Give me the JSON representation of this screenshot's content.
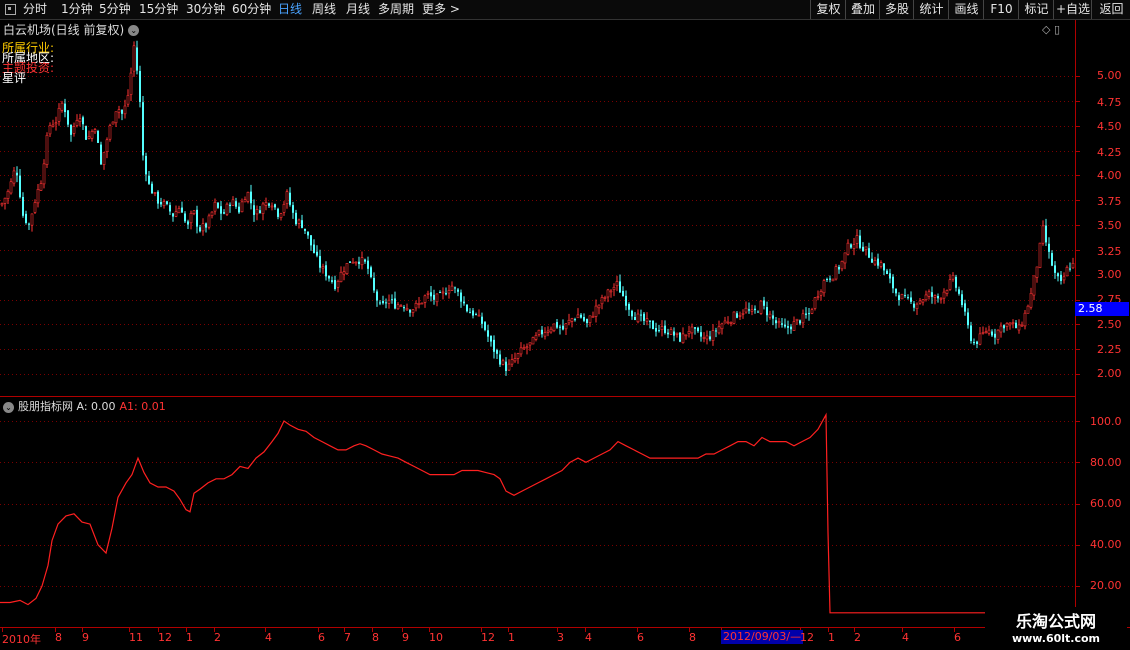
{
  "toolbar": {
    "periods": [
      "分时",
      "1分钟",
      "5分钟",
      "15分钟",
      "30分钟",
      "60分钟",
      "日线",
      "周线",
      "月线",
      "多周期",
      "更多 >"
    ],
    "active_period": "日线",
    "buttons": [
      "复权",
      "叠加",
      "多股",
      "统计",
      "画线",
      "F10",
      "标记",
      "+自选",
      "返回"
    ]
  },
  "main_panel": {
    "title": "白云机场(日线 前复权)",
    "info_lines": [
      {
        "text": "所属行业:",
        "color": "#ffcc00"
      },
      {
        "text": "所属地区:",
        "color": "#ffffff"
      },
      {
        "text": "主题投资:",
        "color": "#ff3333"
      },
      {
        "text": "星评",
        "color": "#ffffff"
      }
    ],
    "price_ticks": [
      "5.00",
      "4.75",
      "4.50",
      "4.25",
      "4.00",
      "3.75",
      "3.50",
      "3.25",
      "3.00",
      "2.75",
      "2.50",
      "2.25",
      "2.00"
    ],
    "current_price": "2.58"
  },
  "indicator_panel": {
    "name": "股朋指标网",
    "a_label": "A: 0.00",
    "a1_label": "A1: 0.01",
    "ticks": [
      "100.0",
      "80.00",
      "60.00",
      "40.00",
      "20.00"
    ]
  },
  "dates": [
    "2010年",
    "8",
    "9",
    "11",
    "12",
    "1",
    "2",
    "4",
    "6",
    "7",
    "8",
    "9",
    "10",
    "12",
    "1",
    "3",
    "4",
    "6",
    "8",
    "12",
    "1",
    "2",
    "4",
    "6"
  ],
  "highlight_date": "2012/09/03/—",
  "watermark": {
    "line1": "乐淘公式网",
    "line2": "www.60lt.com"
  },
  "colors": {
    "up": "#ff3333",
    "down": "#54ffff",
    "grid": "#7a0000",
    "axis": "#b00000",
    "line": "#ff2020"
  },
  "chart_data": {
    "type": "candlestick",
    "price_ylim": [
      2.0,
      5.0
    ],
    "price_path": [
      [
        0,
        3.7
      ],
      [
        8,
        3.85
      ],
      [
        15,
        4.1
      ],
      [
        22,
        3.6
      ],
      [
        28,
        3.5
      ],
      [
        34,
        3.75
      ],
      [
        40,
        3.95
      ],
      [
        48,
        4.5
      ],
      [
        55,
        4.55
      ],
      [
        62,
        4.75
      ],
      [
        70,
        4.4
      ],
      [
        78,
        4.65
      ],
      [
        86,
        4.35
      ],
      [
        94,
        4.5
      ],
      [
        100,
        4.1
      ],
      [
        108,
        4.45
      ],
      [
        116,
        4.7
      ],
      [
        122,
        4.6
      ],
      [
        128,
        4.85
      ],
      [
        133,
        5.3
      ],
      [
        138,
        4.9
      ],
      [
        142,
        4.2
      ],
      [
        148,
        3.9
      ],
      [
        156,
        3.75
      ],
      [
        164,
        3.7
      ],
      [
        172,
        3.6
      ],
      [
        180,
        3.7
      ],
      [
        186,
        3.45
      ],
      [
        192,
        3.65
      ],
      [
        198,
        3.45
      ],
      [
        206,
        3.5
      ],
      [
        214,
        3.7
      ],
      [
        222,
        3.6
      ],
      [
        230,
        3.75
      ],
      [
        238,
        3.65
      ],
      [
        246,
        3.85
      ],
      [
        254,
        3.6
      ],
      [
        262,
        3.7
      ],
      [
        270,
        3.75
      ],
      [
        278,
        3.6
      ],
      [
        286,
        3.8
      ],
      [
        294,
        3.55
      ],
      [
        302,
        3.5
      ],
      [
        310,
        3.3
      ],
      [
        318,
        3.1
      ],
      [
        326,
        3.0
      ],
      [
        334,
        2.9
      ],
      [
        342,
        3.05
      ],
      [
        350,
        3.15
      ],
      [
        358,
        3.15
      ],
      [
        366,
        3.1
      ],
      [
        372,
        2.85
      ],
      [
        380,
        2.65
      ],
      [
        386,
        2.75
      ],
      [
        394,
        2.7
      ],
      [
        402,
        2.7
      ],
      [
        410,
        2.65
      ],
      [
        418,
        2.7
      ],
      [
        426,
        2.8
      ],
      [
        434,
        2.75
      ],
      [
        442,
        2.8
      ],
      [
        450,
        2.9
      ],
      [
        458,
        2.8
      ],
      [
        466,
        2.65
      ],
      [
        474,
        2.6
      ],
      [
        482,
        2.5
      ],
      [
        490,
        2.3
      ],
      [
        498,
        2.15
      ],
      [
        506,
        2.05
      ],
      [
        514,
        2.15
      ],
      [
        522,
        2.25
      ],
      [
        530,
        2.3
      ],
      [
        538,
        2.4
      ],
      [
        546,
        2.45
      ],
      [
        554,
        2.5
      ],
      [
        562,
        2.45
      ],
      [
        570,
        2.55
      ],
      [
        578,
        2.6
      ],
      [
        586,
        2.5
      ],
      [
        594,
        2.65
      ],
      [
        602,
        2.75
      ],
      [
        610,
        2.85
      ],
      [
        616,
        2.9
      ],
      [
        624,
        2.75
      ],
      [
        632,
        2.6
      ],
      [
        640,
        2.55
      ],
      [
        648,
        2.5
      ],
      [
        656,
        2.45
      ],
      [
        664,
        2.45
      ],
      [
        672,
        2.4
      ],
      [
        680,
        2.35
      ],
      [
        688,
        2.45
      ],
      [
        696,
        2.4
      ],
      [
        704,
        2.35
      ],
      [
        712,
        2.4
      ],
      [
        720,
        2.5
      ],
      [
        728,
        2.55
      ],
      [
        736,
        2.6
      ],
      [
        744,
        2.65
      ],
      [
        752,
        2.6
      ],
      [
        760,
        2.7
      ],
      [
        768,
        2.6
      ],
      [
        776,
        2.5
      ],
      [
        784,
        2.45
      ],
      [
        792,
        2.5
      ],
      [
        800,
        2.55
      ],
      [
        808,
        2.6
      ],
      [
        816,
        2.8
      ],
      [
        824,
        2.95
      ],
      [
        832,
        3.0
      ],
      [
        840,
        3.1
      ],
      [
        848,
        3.3
      ],
      [
        856,
        3.35
      ],
      [
        864,
        3.25
      ],
      [
        872,
        3.15
      ],
      [
        880,
        3.1
      ],
      [
        888,
        2.95
      ],
      [
        896,
        2.8
      ],
      [
        904,
        2.75
      ],
      [
        912,
        2.7
      ],
      [
        920,
        2.75
      ],
      [
        928,
        2.8
      ],
      [
        936,
        2.75
      ],
      [
        944,
        2.85
      ],
      [
        952,
        2.95
      ],
      [
        960,
        2.75
      ],
      [
        966,
        2.5
      ],
      [
        972,
        2.3
      ],
      [
        978,
        2.35
      ],
      [
        986,
        2.45
      ],
      [
        994,
        2.4
      ],
      [
        1002,
        2.5
      ],
      [
        1010,
        2.5
      ],
      [
        1018,
        2.45
      ],
      [
        1024,
        2.6
      ],
      [
        1030,
        2.8
      ],
      [
        1036,
        3.1
      ],
      [
        1042,
        3.45
      ],
      [
        1048,
        3.2
      ],
      [
        1054,
        3.0
      ],
      [
        1060,
        2.9
      ],
      [
        1066,
        3.05
      ],
      [
        1070,
        3.1
      ]
    ],
    "indicator_ylim": [
      10,
      104
    ],
    "indicator_path": [
      [
        0,
        12
      ],
      [
        10,
        12
      ],
      [
        20,
        13
      ],
      [
        28,
        11
      ],
      [
        36,
        14
      ],
      [
        42,
        20
      ],
      [
        48,
        30
      ],
      [
        52,
        42
      ],
      [
        58,
        50
      ],
      [
        66,
        54
      ],
      [
        74,
        55
      ],
      [
        82,
        51
      ],
      [
        90,
        50
      ],
      [
        98,
        40
      ],
      [
        106,
        36
      ],
      [
        112,
        48
      ],
      [
        118,
        63
      ],
      [
        126,
        70
      ],
      [
        132,
        74
      ],
      [
        138,
        82
      ],
      [
        144,
        75
      ],
      [
        150,
        70
      ],
      [
        158,
        68
      ],
      [
        166,
        68
      ],
      [
        174,
        66
      ],
      [
        180,
        62
      ],
      [
        186,
        57
      ],
      [
        190,
        56
      ],
      [
        194,
        65
      ],
      [
        200,
        67
      ],
      [
        208,
        70
      ],
      [
        216,
        72
      ],
      [
        224,
        72
      ],
      [
        232,
        74
      ],
      [
        240,
        78
      ],
      [
        248,
        77
      ],
      [
        256,
        82
      ],
      [
        264,
        85
      ],
      [
        272,
        90
      ],
      [
        278,
        94
      ],
      [
        284,
        100
      ],
      [
        290,
        98
      ],
      [
        298,
        96
      ],
      [
        306,
        95
      ],
      [
        314,
        92
      ],
      [
        322,
        90
      ],
      [
        330,
        88
      ],
      [
        338,
        86
      ],
      [
        346,
        86
      ],
      [
        354,
        88
      ],
      [
        360,
        89
      ],
      [
        366,
        88
      ],
      [
        374,
        86
      ],
      [
        382,
        84
      ],
      [
        390,
        83
      ],
      [
        398,
        82
      ],
      [
        406,
        80
      ],
      [
        414,
        78
      ],
      [
        422,
        76
      ],
      [
        430,
        74
      ],
      [
        438,
        74
      ],
      [
        446,
        74
      ],
      [
        454,
        74
      ],
      [
        462,
        76
      ],
      [
        470,
        76
      ],
      [
        478,
        76
      ],
      [
        486,
        75
      ],
      [
        494,
        74
      ],
      [
        500,
        72
      ],
      [
        506,
        66
      ],
      [
        514,
        64
      ],
      [
        522,
        66
      ],
      [
        530,
        68
      ],
      [
        538,
        70
      ],
      [
        546,
        72
      ],
      [
        554,
        74
      ],
      [
        562,
        76
      ],
      [
        570,
        80
      ],
      [
        578,
        82
      ],
      [
        586,
        80
      ],
      [
        594,
        82
      ],
      [
        602,
        84
      ],
      [
        610,
        86
      ],
      [
        618,
        90
      ],
      [
        626,
        88
      ],
      [
        634,
        86
      ],
      [
        642,
        84
      ],
      [
        650,
        82
      ],
      [
        658,
        82
      ],
      [
        666,
        82
      ],
      [
        674,
        82
      ],
      [
        682,
        82
      ],
      [
        690,
        82
      ],
      [
        698,
        82
      ],
      [
        706,
        84
      ],
      [
        714,
        84
      ],
      [
        722,
        86
      ],
      [
        730,
        88
      ],
      [
        738,
        90
      ],
      [
        746,
        90
      ],
      [
        754,
        88
      ],
      [
        762,
        92
      ],
      [
        770,
        90
      ],
      [
        778,
        90
      ],
      [
        786,
        90
      ],
      [
        794,
        88
      ],
      [
        802,
        90
      ],
      [
        810,
        92
      ],
      [
        818,
        96
      ],
      [
        826,
        103
      ],
      [
        828,
        46
      ],
      [
        830,
        7
      ],
      [
        1075,
        7
      ]
    ]
  }
}
